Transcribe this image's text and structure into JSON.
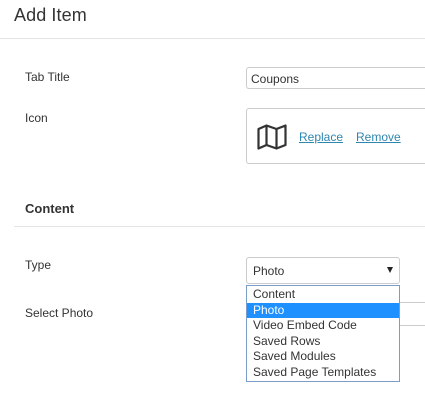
{
  "header": {
    "title": "Add Item"
  },
  "fields": {
    "tab_title": {
      "label": "Tab Title",
      "value": "Coupons"
    },
    "icon": {
      "label": "Icon",
      "icon_name": "map-icon",
      "replace_label": "Replace",
      "remove_label": "Remove"
    }
  },
  "content_section": {
    "title": "Content",
    "type": {
      "label": "Type",
      "selected": "Photo",
      "options": [
        "Content",
        "Photo",
        "Video Embed Code",
        "Saved Rows",
        "Saved Modules",
        "Saved Page Templates"
      ]
    },
    "select_photo": {
      "label": "Select Photo"
    }
  },
  "colors": {
    "link": "#2f86b0",
    "selected_option_bg": "#1e90ff",
    "dropdown_border": "#7a9cc9"
  }
}
